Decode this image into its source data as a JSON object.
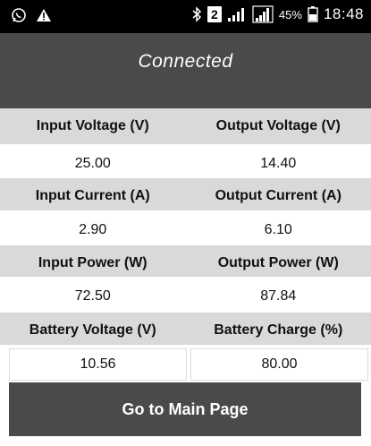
{
  "status_bar": {
    "icons": [
      "whatsapp-icon",
      "warning-icon",
      "bluetooth-icon",
      "sim-2-icon",
      "signal-icon",
      "signal-icon-2",
      "battery-icon"
    ],
    "sim_badge": "2",
    "battery_percent": "45%",
    "time": "18:48"
  },
  "header": {
    "title": "Connected"
  },
  "readings": [
    {
      "left_label": "Input Voltage (V)",
      "right_label": "Output Voltage (V)",
      "left_value": "25.00",
      "right_value": "14.40"
    },
    {
      "left_label": "Input Current (A)",
      "right_label": "Output Current (A)",
      "left_value": "2.90",
      "right_value": "6.10"
    },
    {
      "left_label": "Input Power (W)",
      "right_label": "Output Power (W)",
      "left_value": "72.50",
      "right_value": "87.84"
    },
    {
      "left_label": "Battery Voltage (V)",
      "right_label": "Battery Charge (%)",
      "left_value": "10.56",
      "right_value": "80.00"
    }
  ],
  "button": {
    "label": "Go to Main Page"
  },
  "colors": {
    "header_bg": "#4a4a4a",
    "label_row_bg": "#d9d9d9",
    "button_bg": "#4a4a4a",
    "status_bar_bg": "#000000"
  }
}
